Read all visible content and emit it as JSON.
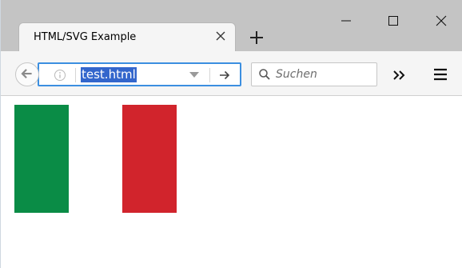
{
  "tab": {
    "title": "HTML/SVG Example"
  },
  "address_bar": {
    "url": "test.html"
  },
  "search": {
    "placeholder": "Suchen"
  },
  "colors": {
    "stripe_green": "#0a8c46",
    "stripe_white": "#ffffff",
    "stripe_red": "#d1242c",
    "url_selection": "#3366cc",
    "url_focus_border": "#3c8fe0"
  },
  "icons": {
    "back": "back-arrow-icon",
    "info": "info-icon",
    "dropdown": "chevron-down-icon",
    "go": "arrow-right-icon",
    "search": "search-icon",
    "overflow": "double-chevron-icon",
    "menu": "hamburger-menu-icon",
    "new_tab": "plus-icon",
    "tab_close": "close-icon",
    "minimize": "minimize-icon",
    "maximize": "maximize-icon",
    "close": "close-icon"
  }
}
